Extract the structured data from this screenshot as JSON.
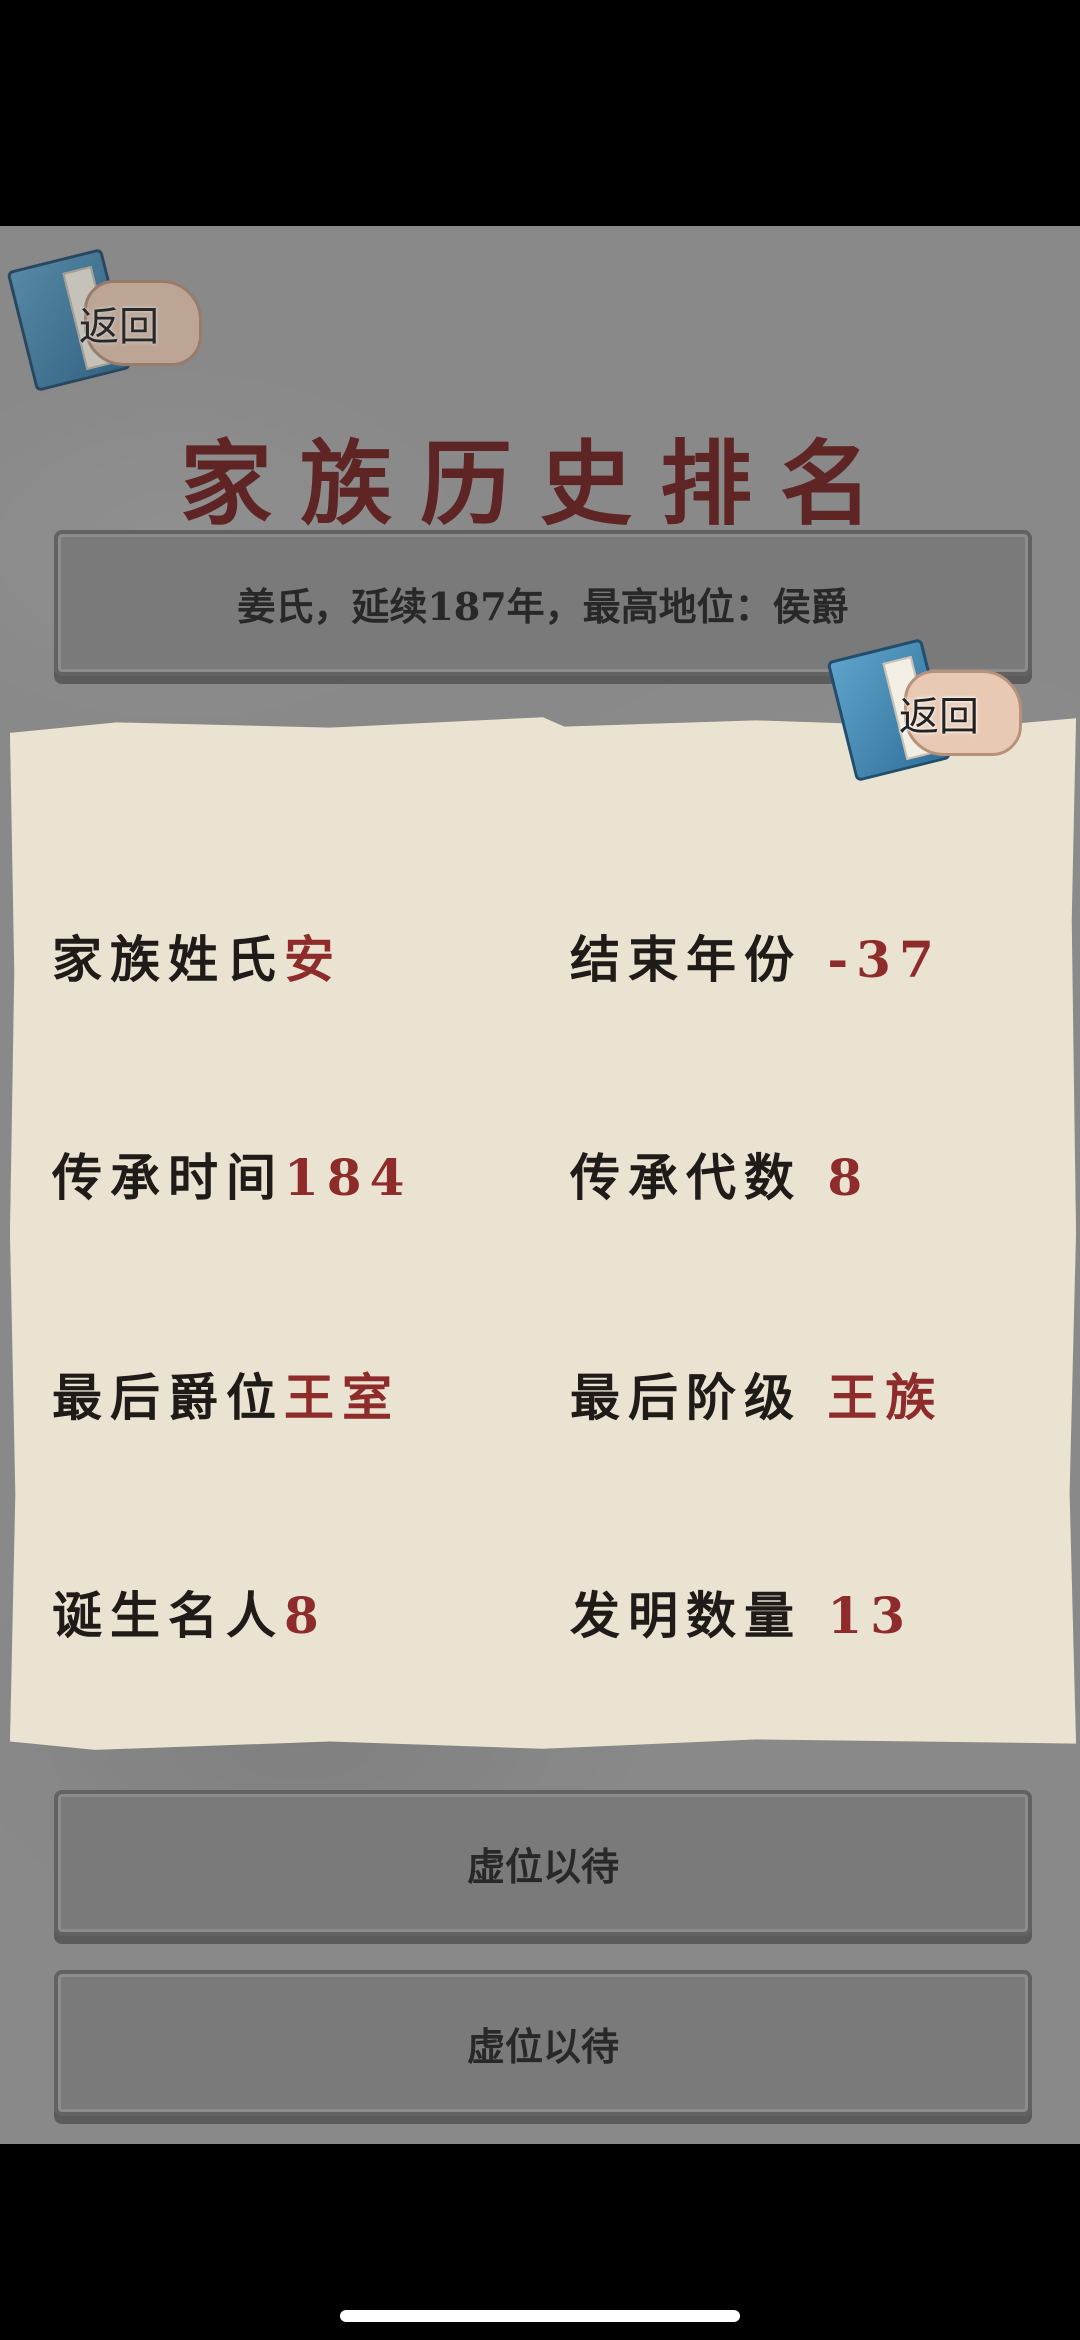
{
  "header": {
    "back_label": "返回",
    "title": "家族历史排名"
  },
  "rankings": [
    {
      "text": "姜氏，延续187年，最高地位：侯爵"
    },
    {
      "text": "虚位以待"
    },
    {
      "text": "虚位以待"
    }
  ],
  "popup": {
    "close_label": "返回",
    "stats": [
      {
        "label": "家族姓氏",
        "value": "安"
      },
      {
        "label": "结束年份",
        "value": "-37"
      },
      {
        "label": "传承时间",
        "value": "184"
      },
      {
        "label": "传承代数",
        "value": "8"
      },
      {
        "label": "最后爵位",
        "value": "王室"
      },
      {
        "label": "最后阶级",
        "value": "王族"
      },
      {
        "label": "诞生名人",
        "value": "8"
      },
      {
        "label": "发明数量",
        "value": "13"
      }
    ]
  },
  "colors": {
    "title": "#6b1d1d",
    "value_accent": "#8e2b2b",
    "paper": "#ebe3d1",
    "background": "#a3a3a3"
  }
}
